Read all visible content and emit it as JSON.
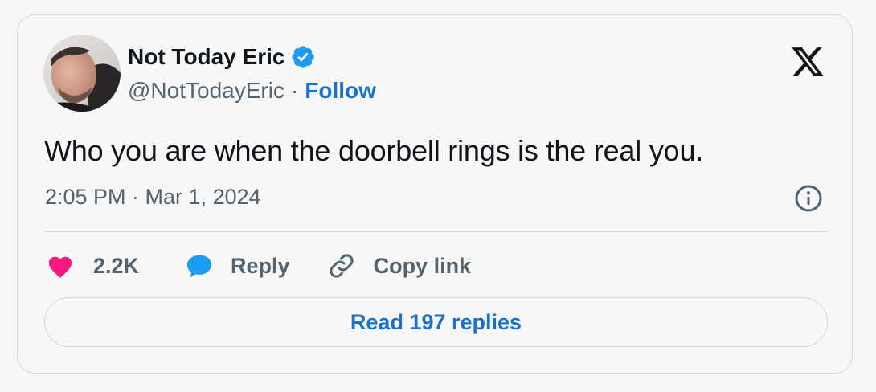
{
  "author": {
    "name": "Not Today Eric",
    "handle": "@NotTodayEric",
    "separator": "·",
    "follow_label": "Follow",
    "verified": true
  },
  "brand": {
    "logo": "x-logo-icon"
  },
  "tweet": {
    "text": "Who you are when the doorbell rings is the real you.",
    "timestamp": "2:05 PM · Mar 1, 2024"
  },
  "actions": {
    "like_count": "2.2K",
    "reply_label": "Reply",
    "copy_link_label": "Copy link"
  },
  "read_replies_label": "Read 197 replies",
  "colors": {
    "accent": "#1d9bf0",
    "link": "#1d72c8",
    "like": "#f91880",
    "text": "#0f1419",
    "muted": "#536471",
    "border": "#cfd9de"
  },
  "icons": [
    "verified-badge-icon",
    "x-logo-icon",
    "info-icon",
    "heart-icon",
    "reply-bubble-icon",
    "link-icon"
  ]
}
